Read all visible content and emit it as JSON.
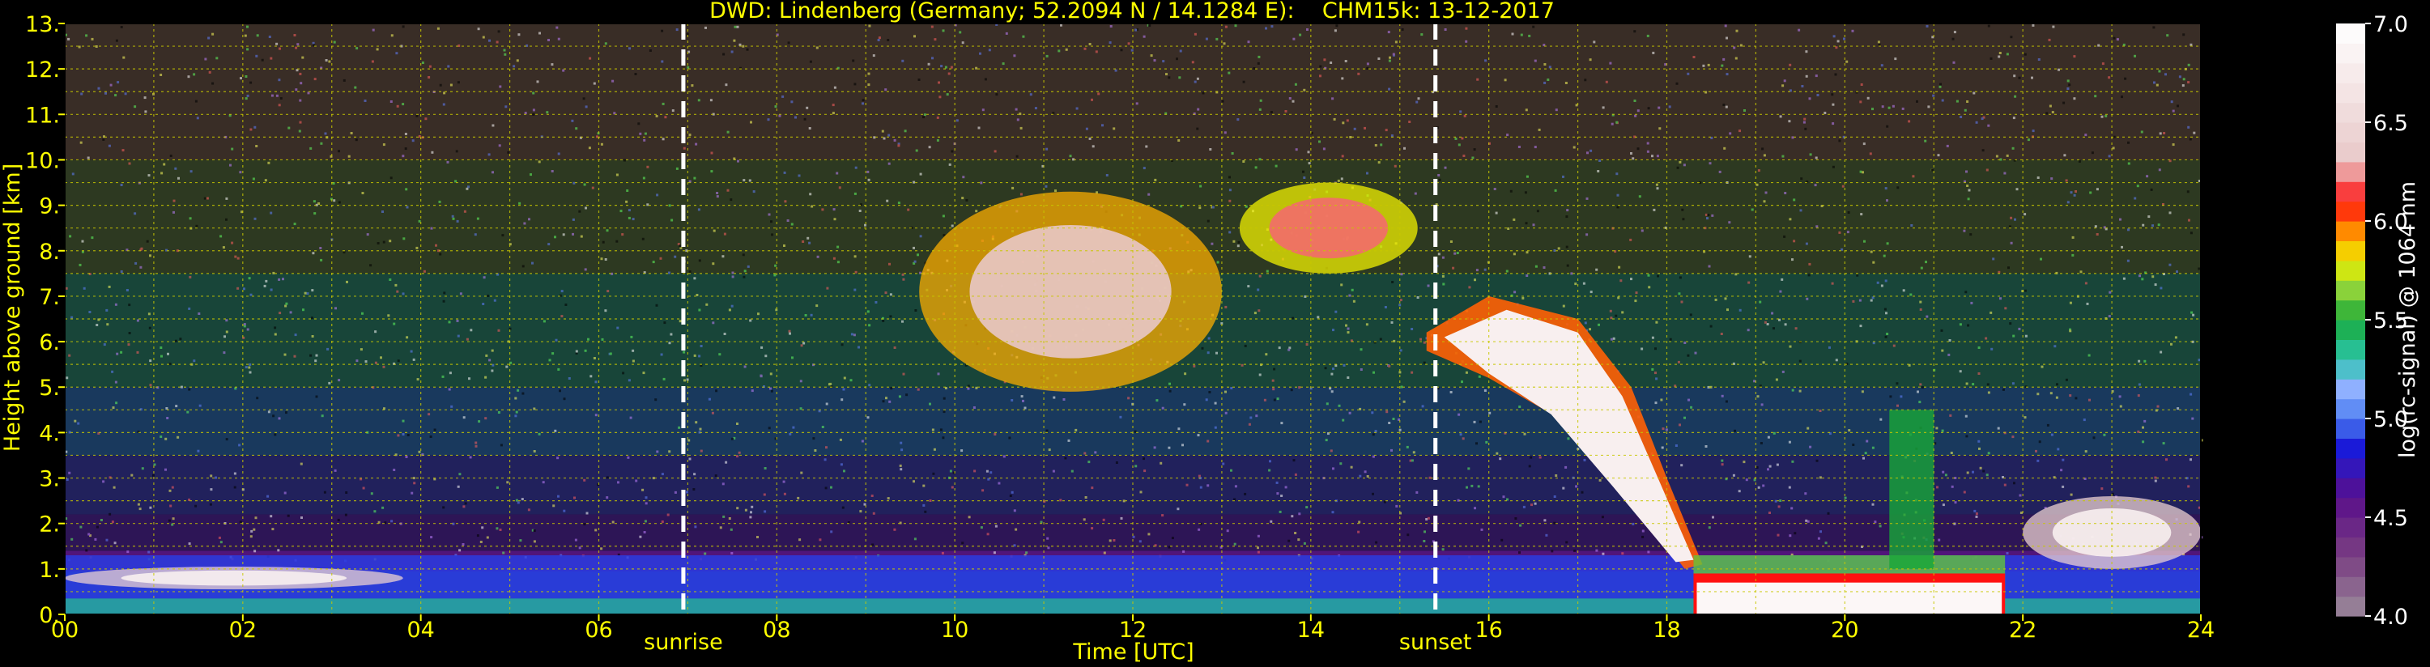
{
  "chart_data": {
    "type": "heatmap",
    "title": "DWD: Lindenberg (Germany; 52.2094 N / 14.1284 E):    CHM15k: 13-12-2017",
    "xlabel": "Time [UTC]",
    "ylabel": "Height above ground [km]",
    "xlim": [
      0,
      24
    ],
    "ylim": [
      0,
      13
    ],
    "x_ticks": [
      "00",
      "02",
      "04",
      "06",
      "08",
      "10",
      "12",
      "14",
      "16",
      "18",
      "20",
      "22",
      "24"
    ],
    "y_ticks": [
      "0.",
      "1.",
      "2.",
      "3.",
      "4.",
      "5.",
      "6.",
      "7.",
      "8.",
      "9.",
      "10.",
      "11.",
      "12.",
      "13."
    ],
    "grid": true,
    "colorbar": {
      "label": "log(rc-signal) @ 1064 nm",
      "range": [
        4.0,
        7.0
      ],
      "ticks": [
        "4.0",
        "4.5",
        "5.0",
        "5.5",
        "6.0",
        "6.5",
        "7.0"
      ]
    },
    "markers": [
      {
        "label": "sunrise",
        "time": 6.95
      },
      {
        "label": "sunset",
        "time": 15.4
      }
    ],
    "colors": {
      "axis_text": "#ffff00",
      "grid": "#c8c800",
      "background": "#000000",
      "marker": "#ffffff"
    },
    "features": [
      {
        "name": "boundary layer aerosol",
        "t0": 0,
        "t1": 24,
        "h0": 0.0,
        "h1": 1.3,
        "value": 5.0
      },
      {
        "name": "low cloud",
        "t0": 0.0,
        "t1": 3.8,
        "h0": 0.55,
        "h1": 1.05,
        "value": 6.8
      },
      {
        "name": "cirrus",
        "t0": 9.6,
        "t1": 13.0,
        "h0": 4.9,
        "h1": 9.3,
        "value": 6.3
      },
      {
        "name": "cirrus",
        "t0": 13.2,
        "t1": 15.2,
        "h0": 7.5,
        "h1": 9.5,
        "value": 6.2
      },
      {
        "name": "thick cloud descending",
        "t0": 15.3,
        "t1": 18.5,
        "h0": 1.0,
        "h1": 8.0,
        "value": 6.8
      },
      {
        "name": "precipitation",
        "t0": 18.3,
        "t1": 21.8,
        "h0": 0.0,
        "h1": 1.3,
        "value": 6.9
      },
      {
        "name": "low cloud",
        "t0": 22.0,
        "t1": 24.0,
        "h0": 1.0,
        "h1": 2.6,
        "value": 6.8
      }
    ]
  }
}
